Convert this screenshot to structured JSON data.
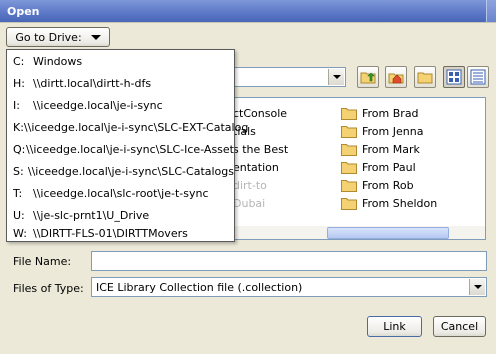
{
  "window": {
    "title": "Open"
  },
  "goto": {
    "label": "Go to Drive:"
  },
  "drives": [
    {
      "letter": "C:",
      "path": "Windows"
    },
    {
      "letter": "H:",
      "path": "\\\\dirtt.local\\dirtt-h-dfs"
    },
    {
      "letter": "I:",
      "path": "\\\\iceedge.local\\je-i-sync"
    },
    {
      "letter": "K:",
      "path": "\\\\iceedge.local\\je-i-sync\\SLC-EXT-Catalog"
    },
    {
      "letter": "Q:",
      "path": "\\\\iceedge.local\\je-i-sync\\SLC-Ice-Asset"
    },
    {
      "letter": "S:",
      "path": "\\\\iceedge.local\\je-i-sync\\SLC-Catalogs"
    },
    {
      "letter": "T:",
      "path": "\\\\iceedge.local\\slc-root\\je-t-sync"
    },
    {
      "letter": "U:",
      "path": "\\\\je-slc-prnt1\\U_Drive"
    },
    {
      "letter": "W:",
      "path": "\\\\DIRTT-FLS-01\\DIRTTMovers"
    }
  ],
  "files": {
    "left_column_partial": [
      "ctConsole",
      "tials",
      "s the Best",
      "entation",
      "dirt-to",
      "Dubai"
    ],
    "right_column": [
      "From Brad",
      "From Jenna",
      "From Mark",
      "From Paul",
      "From Rob",
      "From Sheldon"
    ]
  },
  "toolbar": {
    "up_icon": "up-one-level-icon",
    "home_icon": "home-icon",
    "new_folder_icon": "new-folder-icon",
    "list_icon": "list-view-icon",
    "details_icon": "details-view-icon"
  },
  "form": {
    "file_name_label": "File Name:",
    "file_name_value": "",
    "file_type_label": "Files of Type:",
    "file_type_value": "ICE Library Collection file (.collection)"
  },
  "buttons": {
    "link": "Link",
    "cancel": "Cancel"
  },
  "colors": {
    "title_bar": "#5b77c6",
    "folder": "#f4d172",
    "dialog_bg": "#ece9d8"
  }
}
